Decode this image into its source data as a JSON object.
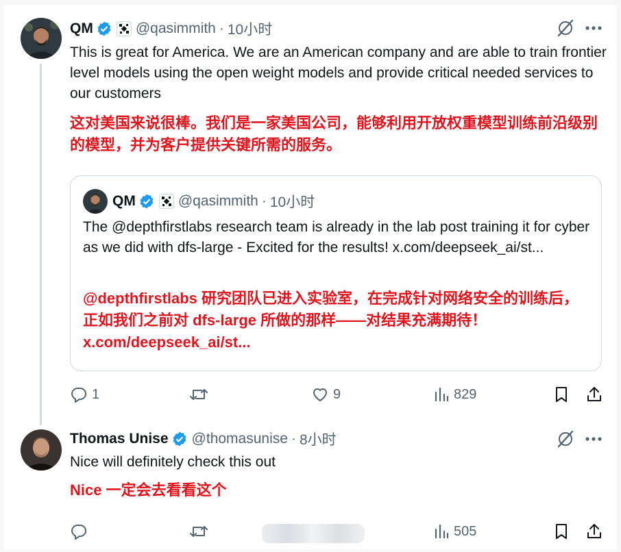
{
  "tweet": {
    "author_name": "QM",
    "handle": "@qasimmith",
    "separator": "·",
    "time": "10小时",
    "text_en": "This is great for America. We are an American company and are able to train frontier level models using the open weight models and provide critical needed services to our customers",
    "text_zh": "这对美国来说很棒。我们是一家美国公司，能够利用开放权重模型训练前沿级别的模型，并为客户提供关键所需的服务。",
    "quote": {
      "author_name": "QM",
      "handle": "@qasimmith",
      "separator": "·",
      "time": "10小时",
      "text_en": "The @depthfirstlabs research team is already in the lab post training it for cyber as we did with dfs-large - Excited for the results! x.com/deepseek_ai/st...",
      "text_zh": "@depthfirstlabs 研究团队已进入实验室，在完成针对网络安全的训练后，正如我们之前对 dfs-large 所做的那样——对结果充满期待！x.com/deepseek_ai/st..."
    },
    "stats": {
      "replies": "1",
      "reposts": "",
      "likes": "9",
      "views": "829"
    }
  },
  "reply": {
    "author_name": "Thomas Unise",
    "handle": "@thomasunise",
    "separator": "·",
    "time": "8小时",
    "text_en": "Nice will definitely check this out",
    "text_zh": "Nice 一定会去看看这个",
    "stats": {
      "replies": "",
      "reposts": "",
      "likes": "",
      "views": "505"
    }
  },
  "icons": {
    "verified": "verified-badge-icon",
    "affiliate": "affiliate-badge-icon",
    "grok": "grok-icon",
    "more": "more-icon",
    "reply": "reply-icon",
    "repost": "repost-icon",
    "like": "like-icon",
    "views": "views-icon",
    "bookmark": "bookmark-icon",
    "share": "share-icon"
  },
  "colors": {
    "verified": "#1d9bf0",
    "text": "#0f1419",
    "secondary": "#536471",
    "translation": "#e0141c",
    "border": "#cfd9de"
  }
}
